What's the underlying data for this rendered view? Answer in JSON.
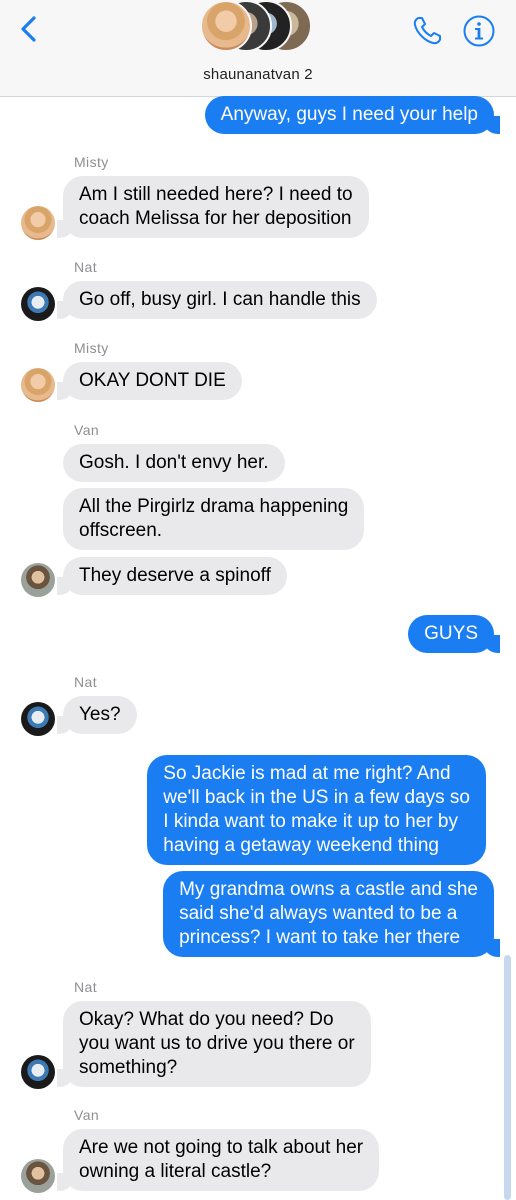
{
  "header": {
    "group_name": "shaunanatvan 2",
    "back_icon": "chevron-left-icon",
    "call_icon": "phone-icon",
    "info_icon": "info-icon",
    "accent": "#1a7ef2"
  },
  "messages": [
    {
      "from": "me",
      "text": "Anyway, guys I need your help"
    },
    {
      "sender": "Misty",
      "text_lines": [
        "Am I still needed here? I need to",
        "coach Melissa for her deposition"
      ]
    },
    {
      "sender": "Nat",
      "text": "Go off, busy girl. I can handle this"
    },
    {
      "sender": "Misty",
      "text": "OKAY DONT DIE"
    },
    {
      "sender": "Van",
      "text": "Gosh. I don't envy her."
    },
    {
      "text_lines": [
        "All the Pirgirlz drama happening",
        "offscreen."
      ]
    },
    {
      "text": "They deserve a spinoff"
    },
    {
      "from": "me",
      "text": "GUYS"
    },
    {
      "sender": "Nat",
      "text": "Yes?"
    },
    {
      "from": "me",
      "text_lines": [
        "So Jackie is mad at me right? And",
        "we'll back in the US in a few days so",
        "I kinda want to make it up to her by",
        "having a getaway weekend thing"
      ]
    },
    {
      "from": "me",
      "text_lines": [
        "My grandma owns a castle and she",
        "said she'd always wanted to be a",
        "princess? I want to take her there"
      ]
    },
    {
      "sender": "Nat",
      "text_lines": [
        "Okay? What do you need? Do",
        "you want us to drive you there or",
        "something?"
      ]
    },
    {
      "sender": "Van",
      "text_lines": [
        "Are we not going to talk about her",
        "owning a literal castle?"
      ]
    }
  ]
}
